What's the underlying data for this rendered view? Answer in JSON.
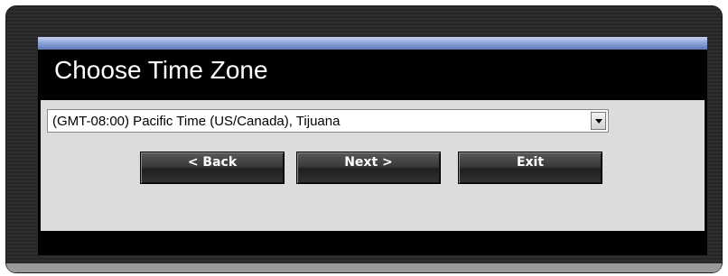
{
  "dialog": {
    "title": "Choose Time Zone"
  },
  "timezone": {
    "selected": "(GMT-08:00) Pacific Time (US/Canada), Tijuana"
  },
  "buttons": {
    "back_label": "< Back",
    "next_label": "Next >",
    "exit_label": "Exit"
  },
  "colors": {
    "dialog_background": "#000000",
    "content_background": "#dcdcdc",
    "header_bar": "#8fa6d8",
    "button": "#3a3a3a"
  },
  "icons": {
    "dropdown": "chevron-down-icon"
  }
}
